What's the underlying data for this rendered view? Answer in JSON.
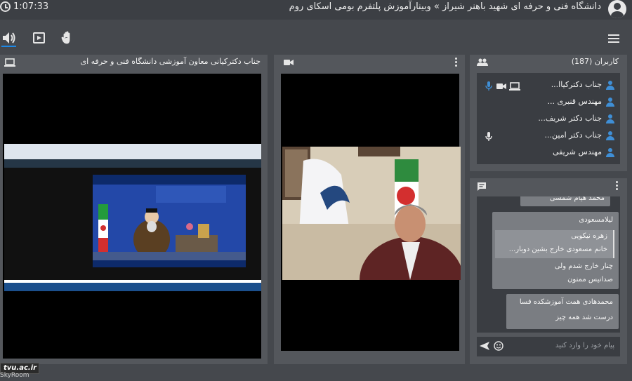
{
  "topbar": {
    "elapsed_time": "1:07:33",
    "meeting_title": "دانشگاه فنی و حرفه ای شهید باهنر شیراز » وبینارآموزش پلتفرم بومی اسکای روم"
  },
  "toolbar": {
    "icons": [
      "speaker-icon",
      "presentation-icon",
      "raise-hand-icon",
      "menu-icon"
    ],
    "accent": "#1e88e5"
  },
  "screen_share": {
    "title": "جناب دکترکیانی معاون آموزشی دانشگاه فنی و حرفه ای"
  },
  "users": {
    "header": "کاربران (187)",
    "list": [
      {
        "name": "جناب دکترکیاا..."
      },
      {
        "name": "مهندس قنبری ..."
      },
      {
        "name": "جناب دکتر شریف..."
      },
      {
        "name": "جناب دکتر امین..."
      },
      {
        "name": "مهندس شریفی"
      }
    ]
  },
  "chat": {
    "truncated_message": "محمد هیام شمسی",
    "message_1": {
      "sender": "لیلامسعودی",
      "quote_name": "زهره نیکویی",
      "quote_text": "خانم مسعودی خارج بشین دوبار...",
      "lines": [
        "چنار خارج شدم ولی",
        "صدانیس ممنون"
      ]
    },
    "message_2": {
      "lines": [
        "محمدهادی همت آموزشکده فسا",
        "درست شد همه چیز"
      ]
    },
    "input_placeholder": "پیام خود را وارد کنید"
  },
  "watermark": {
    "text_main": "tvu.ac.ir",
    "text_below": "SkyRoom"
  }
}
